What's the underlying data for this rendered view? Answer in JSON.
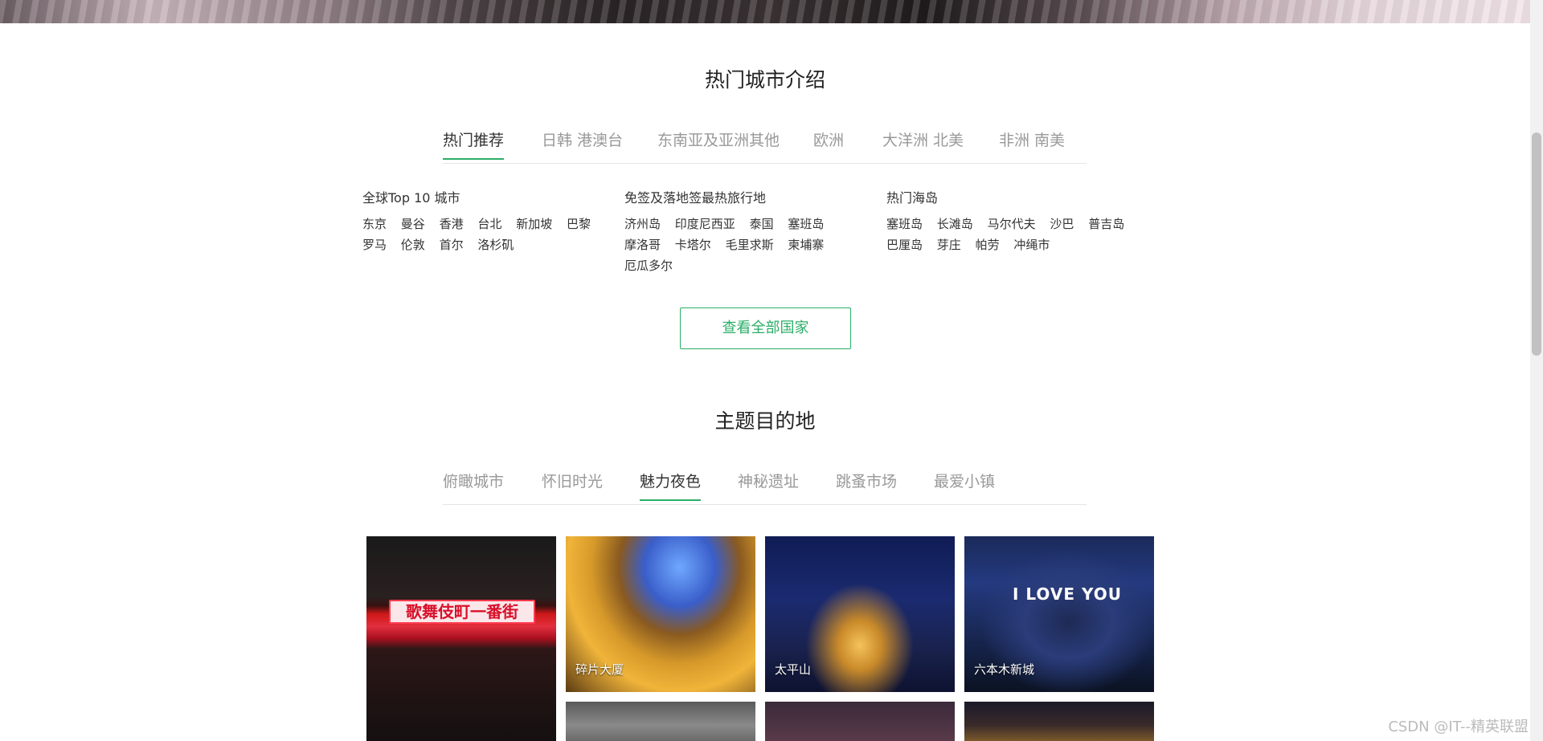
{
  "hot_cities": {
    "title": "热门城市介绍",
    "tabs": [
      {
        "label": "热门推荐",
        "active": true
      },
      {
        "label": "日韩 港澳台",
        "active": false
      },
      {
        "label": "东南亚及亚洲其他",
        "active": false
      },
      {
        "label": "欧洲",
        "active": false
      },
      {
        "label": "大洋洲 北美",
        "active": false
      },
      {
        "label": "非洲 南美",
        "active": false
      }
    ],
    "columns": [
      {
        "title": "全球Top 10 城市",
        "rows": [
          [
            "东京",
            "曼谷",
            "香港",
            "台北",
            "新加坡",
            "巴黎"
          ],
          [
            "罗马",
            "伦敦",
            "首尔",
            "洛杉矶"
          ]
        ]
      },
      {
        "title": "免签及落地签最热旅行地",
        "rows": [
          [
            "济州岛",
            "印度尼西亚",
            "泰国",
            "塞班岛"
          ],
          [
            "摩洛哥",
            "卡塔尔",
            "毛里求斯",
            "柬埔寨"
          ],
          [
            "厄瓜多尔"
          ]
        ]
      },
      {
        "title": "热门海岛",
        "rows": [
          [
            "塞班岛",
            "长滩岛",
            "马尔代夫",
            "沙巴",
            "普吉岛"
          ],
          [
            "巴厘岛",
            "芽庄",
            "帕劳",
            "冲绳市"
          ]
        ]
      }
    ],
    "view_all_label": "查看全部国家"
  },
  "themes": {
    "title": "主题目的地",
    "tabs": [
      {
        "label": "俯瞰城市",
        "active": false
      },
      {
        "label": "怀旧时光",
        "active": false
      },
      {
        "label": "魅力夜色",
        "active": true
      },
      {
        "label": "神秘遗址",
        "active": false
      },
      {
        "label": "跳蚤市场",
        "active": false
      },
      {
        "label": "最爱小镇",
        "active": false
      }
    ],
    "cards": [
      {
        "label": "",
        "sign_text": "歌舞伎町一番街"
      },
      {
        "label": "碎片大厦"
      },
      {
        "label": "太平山"
      },
      {
        "label": "六本木新城",
        "overlay_text": "I LOVE YOU"
      }
    ]
  },
  "watermark": "CSDN @IT--精英联盟",
  "colors": {
    "accent": "#2aae67"
  }
}
